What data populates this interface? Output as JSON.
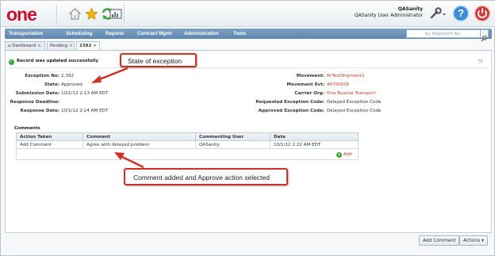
{
  "app": {
    "logo": "one"
  },
  "user": {
    "name": "QASanity",
    "role": "QASanity User Administrator"
  },
  "nav": {
    "items": [
      "Transportation",
      "Scheduling",
      "Reports",
      "Contract Mgmt",
      "Administration",
      "Tools"
    ],
    "search_placeholder": "by Shipment No"
  },
  "tabs": [
    {
      "label": "Dashboard",
      "close": "×"
    },
    {
      "label": "Pending",
      "close": "×"
    },
    {
      "label": "2392",
      "close": "×"
    }
  ],
  "message": {
    "text": "Record was updated successfully",
    "close": "⤧"
  },
  "fields_left": [
    {
      "label": "Exception No:",
      "value": "2,392"
    },
    {
      "label": "State:",
      "value": "Approved"
    },
    {
      "label": "Submission Date:",
      "value": "10/1/12 2:13 AM EDT"
    },
    {
      "label": "Response Deadline:",
      "value": ""
    },
    {
      "label": "Response Date:",
      "value": "10/1/12 2:24 AM EDT"
    }
  ],
  "fields_right": [
    {
      "label": "Movement:",
      "value": "M-TestShipment1",
      "link": true
    },
    {
      "label": "Movement Evt:",
      "value": "40700505",
      "link": true
    },
    {
      "label": "Carrier Org:",
      "value": "One Buelow Transport",
      "link": true
    },
    {
      "label": "Requested Exception Code:",
      "value": "Delayed Exception Code",
      "link": false
    },
    {
      "label": "Approved Exception Code:",
      "value": "Delayed Exception Code",
      "link": false
    }
  ],
  "comments": {
    "title": "Comments",
    "columns": [
      "Action Taken",
      "Comment",
      "Commenting User",
      "Date"
    ],
    "rows": [
      [
        "Add Comment",
        "Agree with delayed problem",
        "QASanity",
        "10/1/12 2:22 AM EDT"
      ]
    ],
    "add_label": "Add"
  },
  "callouts": {
    "state": "State of exception",
    "comment": "Comment added and Approve action selected"
  },
  "actions": {
    "add_comment": "Add Comment",
    "actions": "Actions ▾"
  },
  "colors": {
    "brand": "#c8102e",
    "nav": "#6a8fb6",
    "callout_border": "#d03024",
    "link": "#c0392b",
    "success": "#3aa33a"
  }
}
